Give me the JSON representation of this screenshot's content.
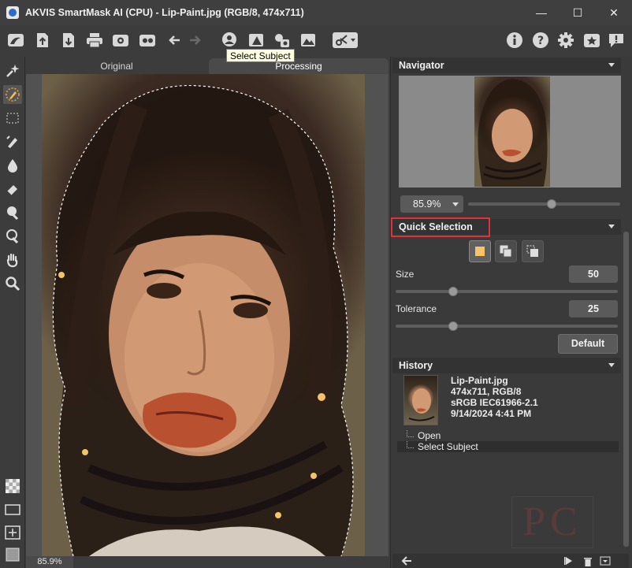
{
  "window": {
    "title": "AKVIS SmartMask AI (CPU) - Lip-Paint.jpg (RGB/8, 474x711)",
    "minimize": "—",
    "maximize": "☐",
    "close": "✕"
  },
  "toolbar": {
    "left_icons": [
      "home-icon",
      "open-icon",
      "save-icon",
      "print-icon",
      "settings-gear-icon",
      "gear-star-icon",
      "undo-arrow-icon",
      "redo-arrow-icon"
    ],
    "select_subject_tooltip": "Select Subject",
    "right_icons": [
      "info-icon",
      "help-icon",
      "preferences-icon",
      "favorites-icon",
      "notifications-icon"
    ]
  },
  "tabs": {
    "original": "Original",
    "processing": "Processing"
  },
  "status": {
    "zoom": "85.9%"
  },
  "navigator": {
    "title": "Navigator",
    "zoom": "85.9%",
    "zoom_slider_fraction": 0.55
  },
  "quick_selection": {
    "title": "Quick Selection",
    "size_label": "Size",
    "size_value": "50",
    "size_slider_fraction": 0.26,
    "tolerance_label": "Tolerance",
    "tolerance_value": "25",
    "tolerance_slider_fraction": 0.26,
    "default_button": "Default"
  },
  "history": {
    "title": "History",
    "file_name": "Lip-Paint.jpg",
    "file_dims": "474x711, RGB/8",
    "color_profile": "sRGB IEC61966-2.1",
    "timestamp": "9/14/2024 4:41 PM",
    "items": [
      "Open",
      "Select Subject"
    ]
  },
  "colors": {
    "accent_highlight": "#e0323c",
    "panel_bg": "#3a3a3a"
  }
}
